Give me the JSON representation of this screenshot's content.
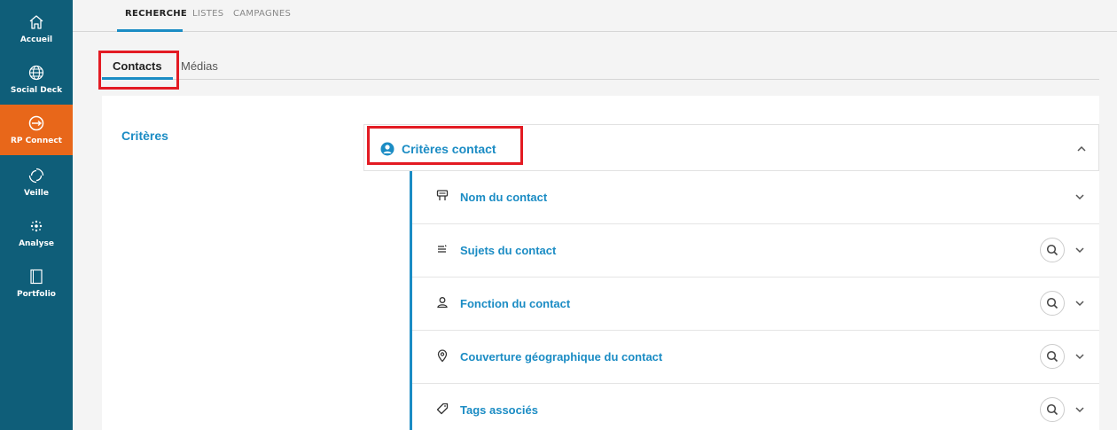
{
  "sidebar": {
    "items": [
      {
        "label": "Accueil",
        "icon": "home-icon"
      },
      {
        "label": "Social Deck",
        "icon": "globe-icon"
      },
      {
        "label": "RP Connect",
        "icon": "rp-connect-icon"
      },
      {
        "label": "Veille",
        "icon": "refresh-icon"
      },
      {
        "label": "Analyse",
        "icon": "scatter-icon"
      },
      {
        "label": "Portfolio",
        "icon": "portfolio-icon"
      }
    ],
    "active": "RP Connect"
  },
  "top_tabs": [
    {
      "label": "RECHERCHE"
    },
    {
      "label": "LISTES"
    },
    {
      "label": "CAMPAGNES"
    }
  ],
  "sub_tabs": [
    {
      "label": "Contacts"
    },
    {
      "label": "Médias"
    }
  ],
  "panel": {
    "criteria_label": "Critères",
    "section_title": "Critères contact",
    "rows": [
      {
        "label": "Nom du contact",
        "icon": "contact-card-icon",
        "has_search": false
      },
      {
        "label": "Sujets du contact",
        "icon": "list-icon",
        "has_search": true
      },
      {
        "label": "Fonction du contact",
        "icon": "person-icon",
        "has_search": true
      },
      {
        "label": "Couverture géographique du contact",
        "icon": "location-pin-icon",
        "has_search": true
      },
      {
        "label": "Tags associés",
        "icon": "tag-icon",
        "has_search": true
      }
    ]
  },
  "colors": {
    "sidebar_bg": "#0f5e79",
    "active_nav": "#e8671a",
    "accent": "#1b8cc4",
    "highlight": "#e31b23"
  }
}
